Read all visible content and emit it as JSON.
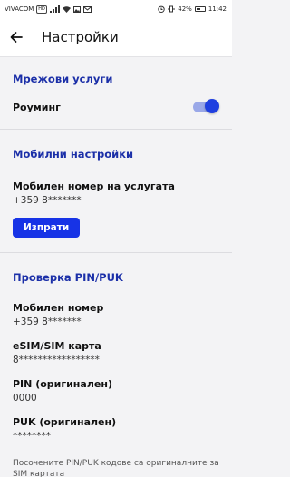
{
  "status_bar": {
    "carrier": "VIVACOM",
    "network_badge": "HD",
    "battery": "42%",
    "time": "11:42"
  },
  "app_bar": {
    "back_icon": "arrow-left-icon",
    "title": "Настройки"
  },
  "network_services": {
    "title": "Мрежови услуги",
    "roaming_label": "Роуминг",
    "roaming_enabled": true
  },
  "mobile_settings": {
    "title": "Мобилни настройки",
    "service_number_label": "Мобилен номер на услугата",
    "service_number_value": "+359 8*******",
    "send_button": "Изпрати"
  },
  "pin_puk": {
    "title": "Проверка PIN/PUK",
    "fields": [
      {
        "label": "Мобилен номер",
        "value": "+359 8*******"
      },
      {
        "label": "eSIM/SIM карта",
        "value": "8*****************"
      },
      {
        "label": "PIN (оригинален)",
        "value": "0000"
      },
      {
        "label": "PUK (оригинален)",
        "value": "********"
      }
    ],
    "note": "Посочените PIN/PUK кодове са оригиналните за SIM картата"
  },
  "colors": {
    "accent": "#1b2fa8",
    "button": "#1733e6",
    "toggle_knob": "#1f3fe0",
    "background": "#f3f3f5"
  }
}
